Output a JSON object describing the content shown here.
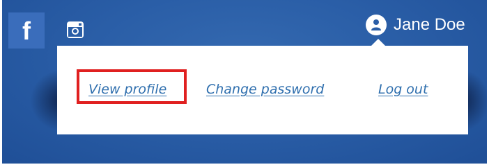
{
  "social": {
    "facebook": {
      "icon": "facebook-icon",
      "glyph": "f"
    },
    "instagram": {
      "icon": "instagram-icon"
    }
  },
  "user": {
    "name": "Jane Doe",
    "avatar_icon": "user-icon"
  },
  "dropdown": {
    "items": [
      {
        "label": "View profile"
      },
      {
        "label": "Change password"
      },
      {
        "label": "Log out"
      }
    ],
    "highlighted_item": "View profile"
  },
  "colors": {
    "background": "#2a5ea7",
    "link": "#2f6fae",
    "highlight_box": "#e02020",
    "facebook_tile": "#3a6dbb"
  }
}
